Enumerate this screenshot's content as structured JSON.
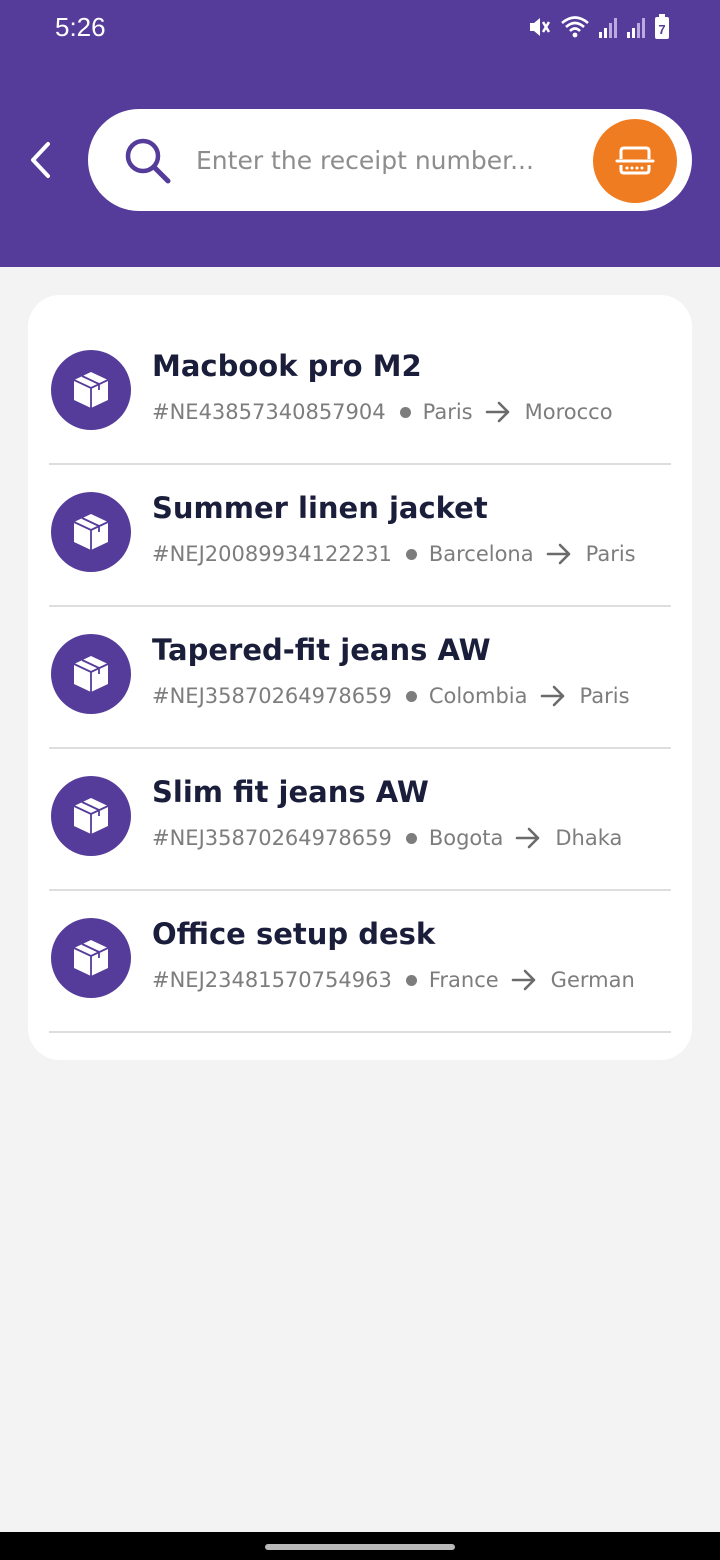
{
  "status_bar": {
    "time": "5:26",
    "battery": "7"
  },
  "search": {
    "placeholder": "Enter the receipt number..."
  },
  "shipments": [
    {
      "title": "Macbook pro M2",
      "receipt": "#NE43857340857904",
      "from": "Paris",
      "to": "Morocco"
    },
    {
      "title": "Summer linen jacket",
      "receipt": "#NEJ20089934122231",
      "from": "Barcelona",
      "to": "Paris"
    },
    {
      "title": "Tapered-fit jeans AW",
      "receipt": "#NEJ35870264978659",
      "from": "Colombia",
      "to": "Paris"
    },
    {
      "title": "Slim fit jeans AW",
      "receipt": "#NEJ35870264978659",
      "from": "Bogota",
      "to": "Dhaka"
    },
    {
      "title": "Office setup desk",
      "receipt": "#NEJ23481570754963",
      "from": "France",
      "to": "German"
    }
  ],
  "colors": {
    "primary": "#553c9a",
    "accent": "#f07c21",
    "background": "#f3f3f3"
  },
  "icons": {
    "back": "chevron-left-icon",
    "search": "search-icon",
    "scan": "barcode-scan-icon",
    "item": "package-box-icon",
    "route": "arrow-right-icon"
  }
}
